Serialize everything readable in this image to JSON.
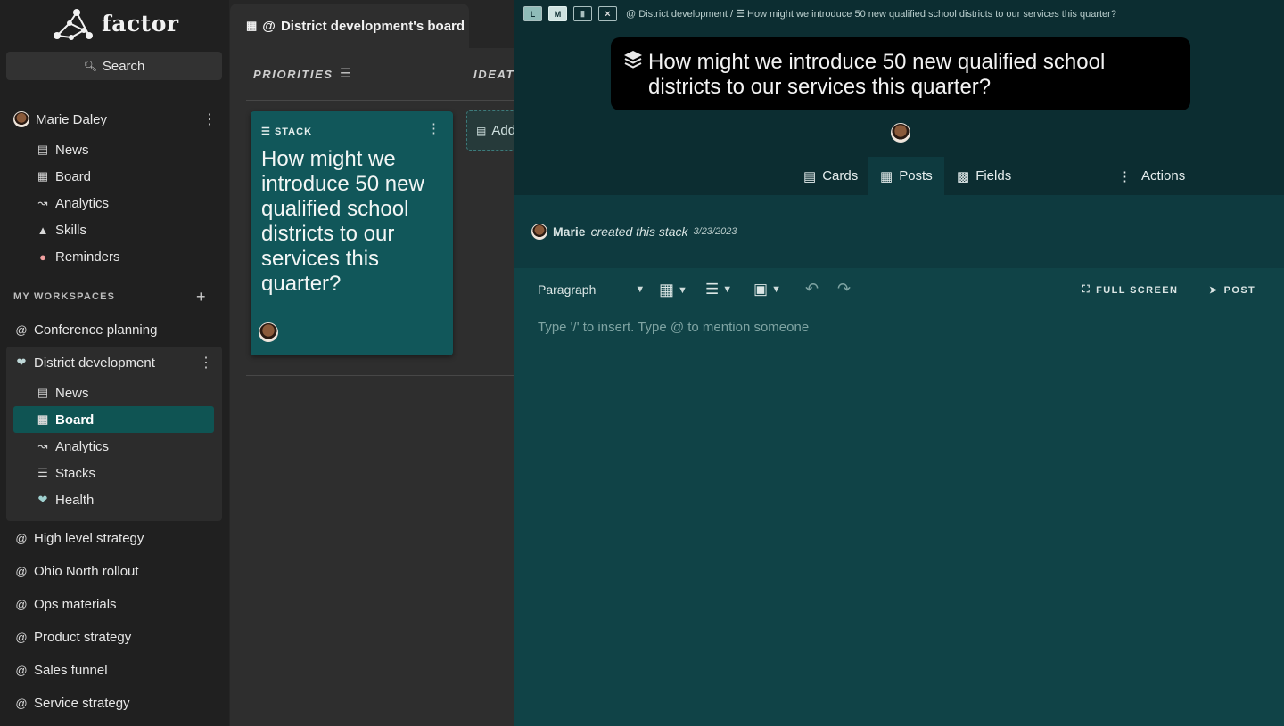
{
  "app": {
    "name": "factor"
  },
  "search": {
    "label": "Search"
  },
  "user": {
    "name": "Marie Daley",
    "items": [
      {
        "label": "News",
        "icon": "news-icon"
      },
      {
        "label": "Board",
        "icon": "board-icon"
      },
      {
        "label": "Analytics",
        "icon": "analytics-icon"
      },
      {
        "label": "Skills",
        "icon": "skills-icon"
      },
      {
        "label": "Reminders",
        "icon": "bell-icon"
      }
    ]
  },
  "workspaces": {
    "title": "MY WORKSPACES",
    "list_before": [
      {
        "label": "Conference planning"
      }
    ],
    "current": {
      "label": "District development",
      "items": [
        {
          "label": "News",
          "icon": "news-icon"
        },
        {
          "label": "Board",
          "icon": "board-icon",
          "active": true
        },
        {
          "label": "Analytics",
          "icon": "analytics-icon"
        },
        {
          "label": "Stacks",
          "icon": "stacks-icon"
        },
        {
          "label": "Health",
          "icon": "health-icon"
        }
      ]
    },
    "list_after": [
      {
        "label": "High level strategy"
      },
      {
        "label": "Ohio North rollout"
      },
      {
        "label": "Ops materials"
      },
      {
        "label": "Product strategy"
      },
      {
        "label": "Sales funnel"
      },
      {
        "label": "Service strategy"
      }
    ]
  },
  "board": {
    "tab_title": "District development's board",
    "columns": [
      "PRIORITIES",
      "IDEATI"
    ],
    "card": {
      "type_label": "STACK",
      "title": "How might we introduce 50 new qualified school districts to our services this quarter?"
    },
    "add_label": "Add"
  },
  "panel": {
    "size_buttons": [
      "L",
      "M"
    ],
    "breadcrumb": {
      "workspace": "District development",
      "separator": "/",
      "stack": "How might we introduce 50 new qualified school districts to our services this quarter?"
    },
    "title": "How might we introduce 50 new qualified school districts to our services this quarter?",
    "tabs": [
      {
        "label": "Cards",
        "icon": "cards-icon"
      },
      {
        "label": "Posts",
        "icon": "posts-icon",
        "active": true
      },
      {
        "label": "Fields",
        "icon": "fields-icon"
      },
      {
        "label": "Actions",
        "icon": "kebab-icon"
      }
    ],
    "activity": {
      "who": "Marie",
      "what": "created this stack",
      "when": "3/23/2023"
    },
    "editor": {
      "block_type": "Paragraph",
      "full_screen_label": "FULL SCREEN",
      "post_label": "POST",
      "placeholder": "Type '/' to insert. Type @ to mention someone"
    }
  },
  "colors": {
    "sidebar_bg": "#202020",
    "active_item": "#0f5453",
    "card_bg": "#11575a",
    "panel_bg": "#0e3a3f",
    "editor_bg": "#104347"
  }
}
